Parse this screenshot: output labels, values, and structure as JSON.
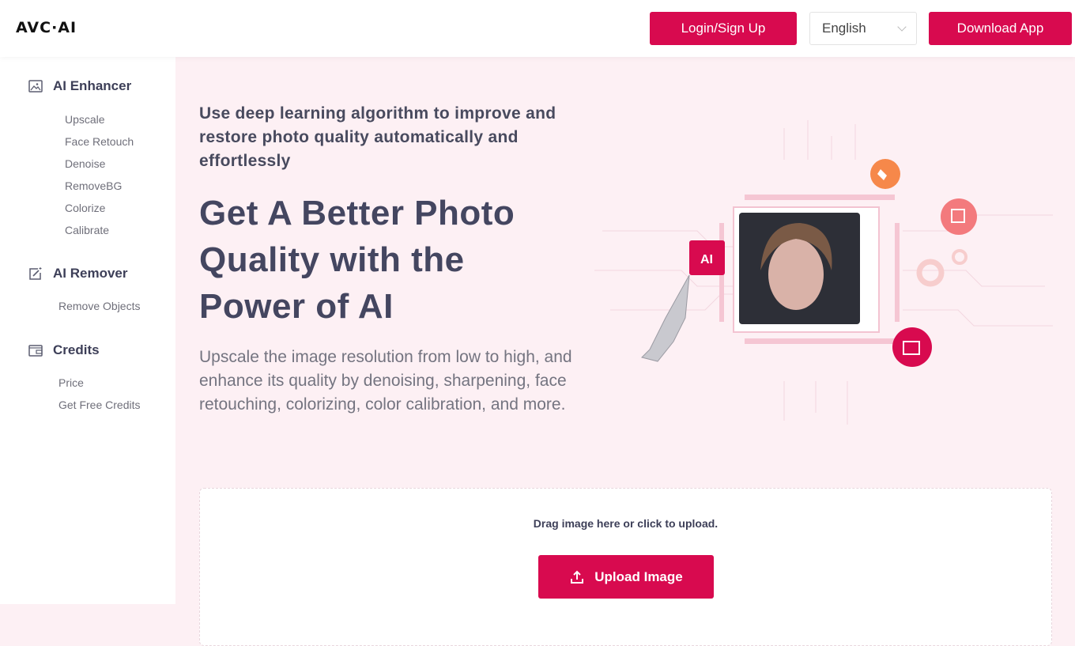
{
  "header": {
    "logo": "AVC·AI",
    "login_label": "Login/Sign Up",
    "language": "English",
    "download_label": "Download App"
  },
  "sidebar": {
    "groups": [
      {
        "title": "AI Enhancer",
        "icon": "image-icon",
        "items": [
          "Upscale",
          "Face Retouch",
          "Denoise",
          "RemoveBG",
          "Colorize",
          "Calibrate"
        ]
      },
      {
        "title": "AI Remover",
        "icon": "edit-magic-icon",
        "items": [
          "Remove Objects"
        ]
      },
      {
        "title": "Credits",
        "icon": "wallet-icon",
        "items": [
          "Price",
          "Get Free Credits"
        ]
      }
    ]
  },
  "main": {
    "tagline": "Use deep learning algorithm to improve and restore photo quality automatically and effortlessly",
    "headline": "Get A Better Photo Quality with the Power of AI",
    "description": "Upscale the image resolution from low to high, and enhance its quality by denoising, sharpening, face retouching, colorizing, color calibration, and more.",
    "hero": {
      "ai_badge": "AI"
    },
    "upload": {
      "hint": "Drag image here or click to upload.",
      "button_label": "Upload Image"
    }
  },
  "colors": {
    "brand": "#d80a4f",
    "page_bg": "#fdf0f4",
    "heading": "#444660",
    "orange_icon": "#f6884a",
    "salmon_icon": "#f37a7d"
  }
}
